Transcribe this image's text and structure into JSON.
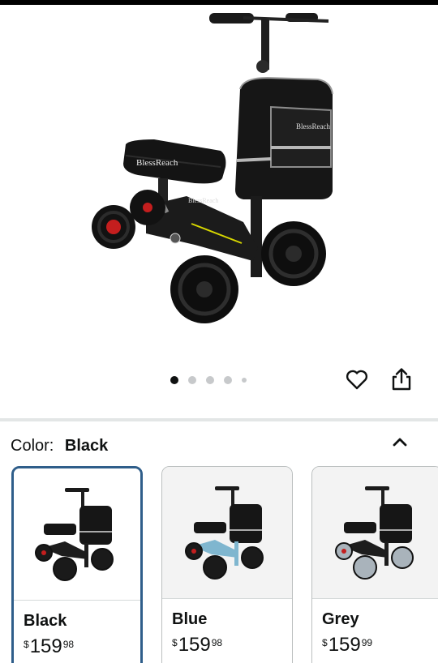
{
  "product": {
    "brand_logo": "BlessReach",
    "image_alt": "knee-scooter-black"
  },
  "gallery": {
    "dots": [
      "active",
      "inactive",
      "inactive",
      "inactive",
      "small"
    ]
  },
  "actions": {
    "favorite_icon": "heart-icon",
    "share_icon": "share-icon"
  },
  "color_selector": {
    "label": "Color:",
    "selected": "Black",
    "collapse_icon": "chevron-up-icon",
    "options": [
      {
        "name": "Black",
        "currency": "$",
        "whole": "159",
        "fraction": "98",
        "frame_color": "#1d1d1d",
        "wheel_color": "#1a1a1a"
      },
      {
        "name": "Blue",
        "currency": "$",
        "whole": "159",
        "fraction": "98",
        "frame_color": "#7fb6cf",
        "wheel_color": "#1a1a1a"
      },
      {
        "name": "Grey",
        "currency": "$",
        "whole": "159",
        "fraction": "99",
        "frame_color": "#1d1d1d",
        "wheel_color": "#a9b3bb"
      }
    ]
  }
}
